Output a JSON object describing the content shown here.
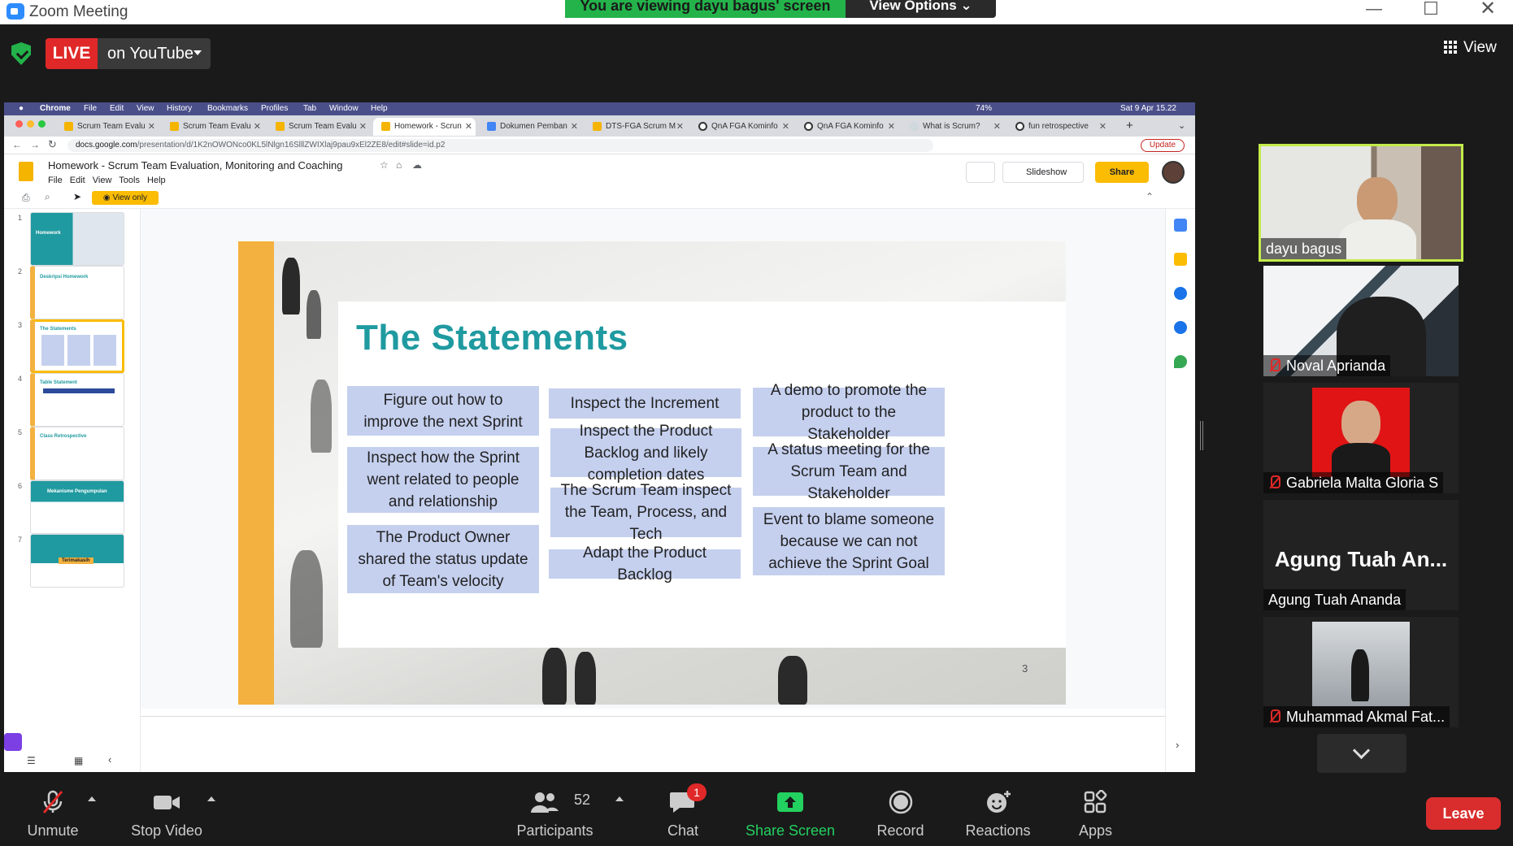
{
  "window": {
    "title": "Zoom Meeting",
    "banner": "You are viewing dayu bagus' screen",
    "view_options": "View Options"
  },
  "topbar": {
    "live_badge": "LIVE",
    "live_target": "on YouTube",
    "view_label": "View"
  },
  "mac_menu": {
    "app": "Chrome",
    "items": [
      "File",
      "Edit",
      "View",
      "History",
      "Bookmarks",
      "Profiles",
      "Tab",
      "Window",
      "Help"
    ],
    "battery": "74%",
    "clock": "Sat 9 Apr  15.22"
  },
  "browser_tabs": [
    {
      "label": "Scrum Team Evalu"
    },
    {
      "label": "Scrum Team Evalu"
    },
    {
      "label": "Scrum Team Evalu"
    },
    {
      "label": "Homework - Scrun",
      "active": true
    },
    {
      "label": "Dokumen Pemban"
    },
    {
      "label": "DTS-FGA Scrum M"
    },
    {
      "label": "QnA FGA Kominfo"
    },
    {
      "label": "QnA FGA Kominfo"
    },
    {
      "label": "What is Scrum?"
    },
    {
      "label": "fun retrospective"
    }
  ],
  "address": {
    "url_host": "docs.google.com",
    "url_path": "/presentation/d/1K2nOWONco0KL5lNlgn16SlllZWIXlaj9pau9xEl2ZE8/edit#slide=id.p2",
    "update_label": "Update"
  },
  "slides_app": {
    "doc_title": "Homework - Scrum Team Evaluation, Monitoring and Coaching",
    "menu": "File Edit View Tools Help",
    "slideshow_label": "Slideshow",
    "share_label": "Share",
    "view_only": "View only",
    "thumbnails": [
      {
        "num": "1",
        "title": "Homework"
      },
      {
        "num": "2",
        "title": "Deskripsi Homework"
      },
      {
        "num": "3",
        "title": "The Statements"
      },
      {
        "num": "4",
        "title": "Table Statement"
      },
      {
        "num": "5",
        "title": "Class Retrospective"
      },
      {
        "num": "6",
        "title": "Mekanisme Pengumpulan"
      },
      {
        "num": "7",
        "title": "Terimakasih"
      }
    ]
  },
  "slide": {
    "title": "The Statements",
    "page_number": "3",
    "statements": [
      "Figure out how to improve the next Sprint",
      "Inspect how the Sprint went related to people and relationship",
      "The Product Owner shared the status update of Team's velocity",
      "Inspect the Increment",
      "Inspect the Product Backlog and likely completion dates",
      "The Scrum Team inspect the Team, Process, and Tech",
      "Adapt the Product Backlog",
      "A demo to promote the product to the Stakeholder",
      "A status meeting for the Scrum Team and Stakeholder",
      "Event to blame someone because we can not achieve the Sprint Goal"
    ]
  },
  "participants": [
    {
      "name": "dayu bagus",
      "muted": false
    },
    {
      "name": "Noval Aprianda",
      "muted": true
    },
    {
      "name": "Gabriela Malta Gloria S",
      "muted": true
    },
    {
      "name": "Agung Tuah Ananda",
      "display": "Agung Tuah An...",
      "muted": false
    },
    {
      "name": "Muhammad Akmal Fat...",
      "muted": true
    }
  ],
  "toolbar": {
    "unmute": "Unmute",
    "stop_video": "Stop Video",
    "participants": "Participants",
    "participant_count": "52",
    "chat": "Chat",
    "chat_badge": "1",
    "share_screen": "Share Screen",
    "record": "Record",
    "reactions": "Reactions",
    "apps": "Apps",
    "leave": "Leave"
  },
  "colors": {
    "zoom_green": "#23b34a",
    "live_red": "#e02828",
    "slide_teal": "#1f9aa0",
    "slide_yellow": "#f3b13f",
    "statement_blue": "#c5d0ef",
    "leave_red": "#d92d2d",
    "speaker_border": "#c3ec4a"
  }
}
